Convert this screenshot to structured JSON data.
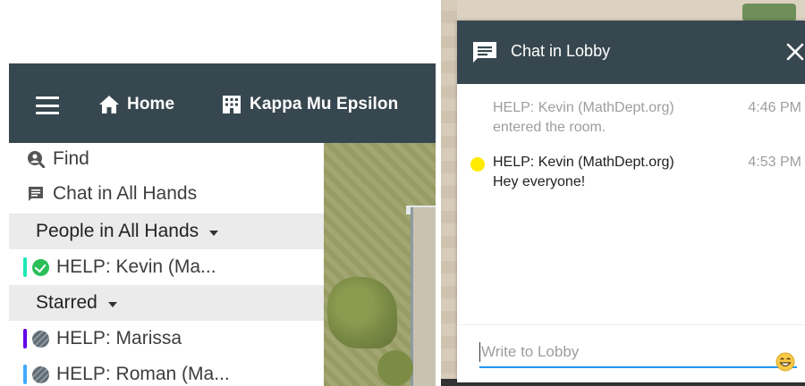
{
  "topbar": {
    "home_label": "Home",
    "room_label": "Kappa Mu Epsilon"
  },
  "sidebar": {
    "find_label": "Find",
    "chat_all_label": "Chat in All Hands",
    "people_header": "People in All Hands",
    "people": [
      {
        "name": "HELP: Kevin (Ma...",
        "bar_color": "#1de9b6",
        "status": "online"
      }
    ],
    "starred_header": "Starred",
    "starred": [
      {
        "name": "HELP: Marissa",
        "bar_color": "#6200ea",
        "status": "away"
      },
      {
        "name": "HELP: Roman (Ma...",
        "bar_color": "#40a9ff",
        "status": "away"
      }
    ]
  },
  "chat": {
    "title": "Chat in Lobby",
    "messages": [
      {
        "author": "HELP: Kevin (MathDept.org)",
        "time": "4:46 PM",
        "text": "entered the room."
      },
      {
        "author": "HELP: Kevin (MathDept.org)",
        "time": "4:53 PM",
        "text": "Hey everyone!"
      }
    ],
    "input_placeholder": "Write to Lobby"
  },
  "colors": {
    "header_bg": "#37474f",
    "accent_blue": "#2196f3",
    "online_green": "#2bbf5a",
    "presence_dot": "#ffea00"
  },
  "icons": [
    "menu-icon",
    "home-icon",
    "building-icon",
    "search-user-icon",
    "chat-icon",
    "check-icon",
    "away-icon",
    "close-icon",
    "emoji-icon"
  ]
}
